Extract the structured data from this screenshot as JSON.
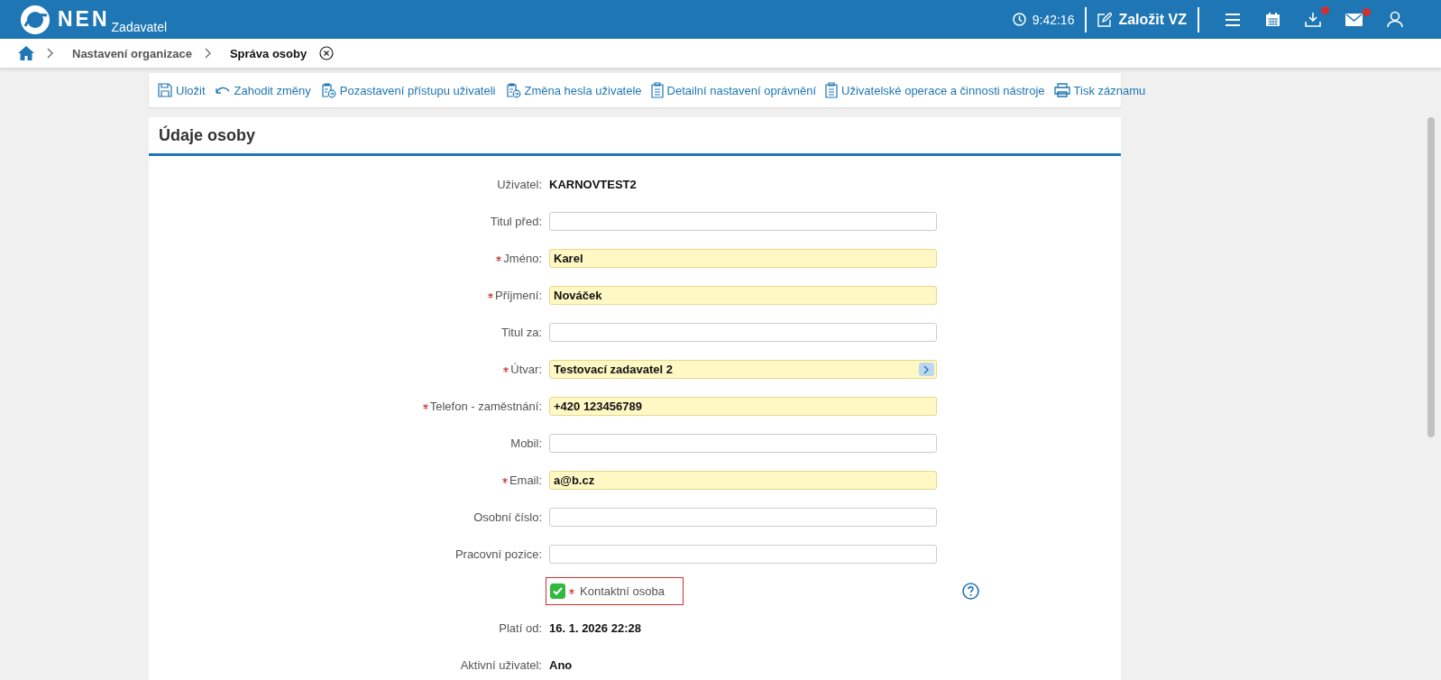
{
  "header": {
    "logo": "NEN",
    "subtitle": "Zadavatel",
    "time": "9:42:16",
    "create_button": "Založit VZ",
    "icons": [
      {
        "kind": "menu",
        "badge": false
      },
      {
        "kind": "calendar",
        "badge": false
      },
      {
        "kind": "download",
        "badge": true
      },
      {
        "kind": "mail",
        "badge": true
      },
      {
        "kind": "user",
        "badge": false
      }
    ]
  },
  "breadcrumb": [
    {
      "label": "Nastavení organizace",
      "selected": false
    },
    {
      "label": "Správa osoby",
      "selected": true
    }
  ],
  "toolbar": [
    {
      "kind": "save",
      "label": "Uložit"
    },
    {
      "kind": "undo",
      "label": "Zahodit změny"
    },
    {
      "kind": "clipboard-arrow",
      "label": "Pozastavení přístupu uživateli"
    },
    {
      "kind": "clipboard-arrow",
      "label": "Změna hesla uživatele"
    },
    {
      "kind": "clipboard",
      "label": "Detailní nastavení oprávnění"
    },
    {
      "kind": "clipboard",
      "label": "Uživatelské operace a činnosti nástroje"
    },
    {
      "kind": "print",
      "label": "Tisk záznamu"
    }
  ],
  "panel": {
    "title": "Údaje osoby",
    "rows": [
      {
        "kind": "text",
        "label": "Uživatel:",
        "value": "KARNOVTEST2",
        "required": false
      },
      {
        "kind": "input",
        "label": "Titul před:",
        "required": false
      },
      {
        "kind": "input",
        "label": "Jméno:",
        "value": "Karel",
        "required": true
      },
      {
        "kind": "input",
        "label": "Příjmení:",
        "value": "Nováček",
        "required": true
      },
      {
        "kind": "input",
        "label": "Titul za:",
        "required": false
      },
      {
        "kind": "lookup",
        "label": "Útvar:",
        "value": "Testovací zadavatel 2",
        "required": true
      },
      {
        "kind": "input",
        "label": "Telefon - zaměstnání:",
        "value": "+420 123456789",
        "required": true
      },
      {
        "kind": "input",
        "label": "Mobil:",
        "required": false
      },
      {
        "kind": "input",
        "label": "Email:",
        "value": "a@b.cz",
        "required": true
      },
      {
        "kind": "input",
        "label": "Osobní číslo:",
        "required": false
      },
      {
        "kind": "input",
        "label": "Pracovní pozice:",
        "required": false
      },
      {
        "kind": "checkbox",
        "label": "Kontaktní osoba",
        "required": true,
        "checked": true,
        "invalid": true,
        "help": true
      },
      {
        "kind": "text",
        "label": "Platí od:",
        "value": "16. 1. 2026 22:28",
        "required": false
      },
      {
        "kind": "text",
        "label": "Aktivní uživatel:",
        "value": "Ano",
        "required": false
      }
    ]
  }
}
